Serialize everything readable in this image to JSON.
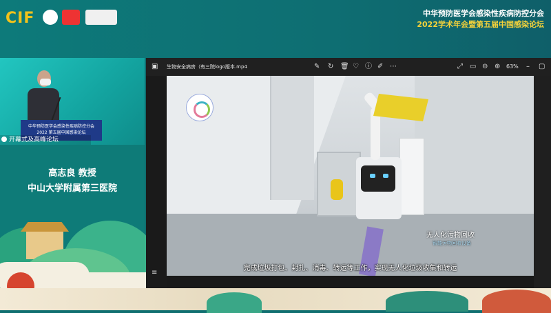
{
  "banner": {
    "logo_text": "CIF",
    "org_line1": "中华预防医学会感染性疾病防控分会",
    "org_line2": "2022学术年会暨第五届中国感染论坛"
  },
  "left_panel": {
    "session_label": "开幕式及高峰论坛",
    "podium_line1": "中华预防医学会感染性疾病防控分会",
    "podium_line2": "2022 第五届中国感染论坛",
    "speaker_name": "高志良 教授",
    "speaker_affiliation": "中山大学附属第三医院"
  },
  "viewer": {
    "file_title": "生物安全病房（有三院logo版本.mp4",
    "zoom": "63%",
    "icons": [
      "pen-icon",
      "rotate-icon",
      "delete-icon",
      "heart-icon",
      "info-icon",
      "edit-icon",
      "more-icon",
      "expand-icon",
      "fit-icon",
      "zoom-out-icon",
      "zoom-in-icon",
      "minimize-icon",
      "maximize-icon"
    ]
  },
  "video": {
    "overlay_title": "无人化污物回收",
    "overlay_sub": "智能污物回收设备",
    "subtitle": "完成垃圾打包、封扎、消毒、转运等工作，实现无人化垃圾收集和转运"
  }
}
